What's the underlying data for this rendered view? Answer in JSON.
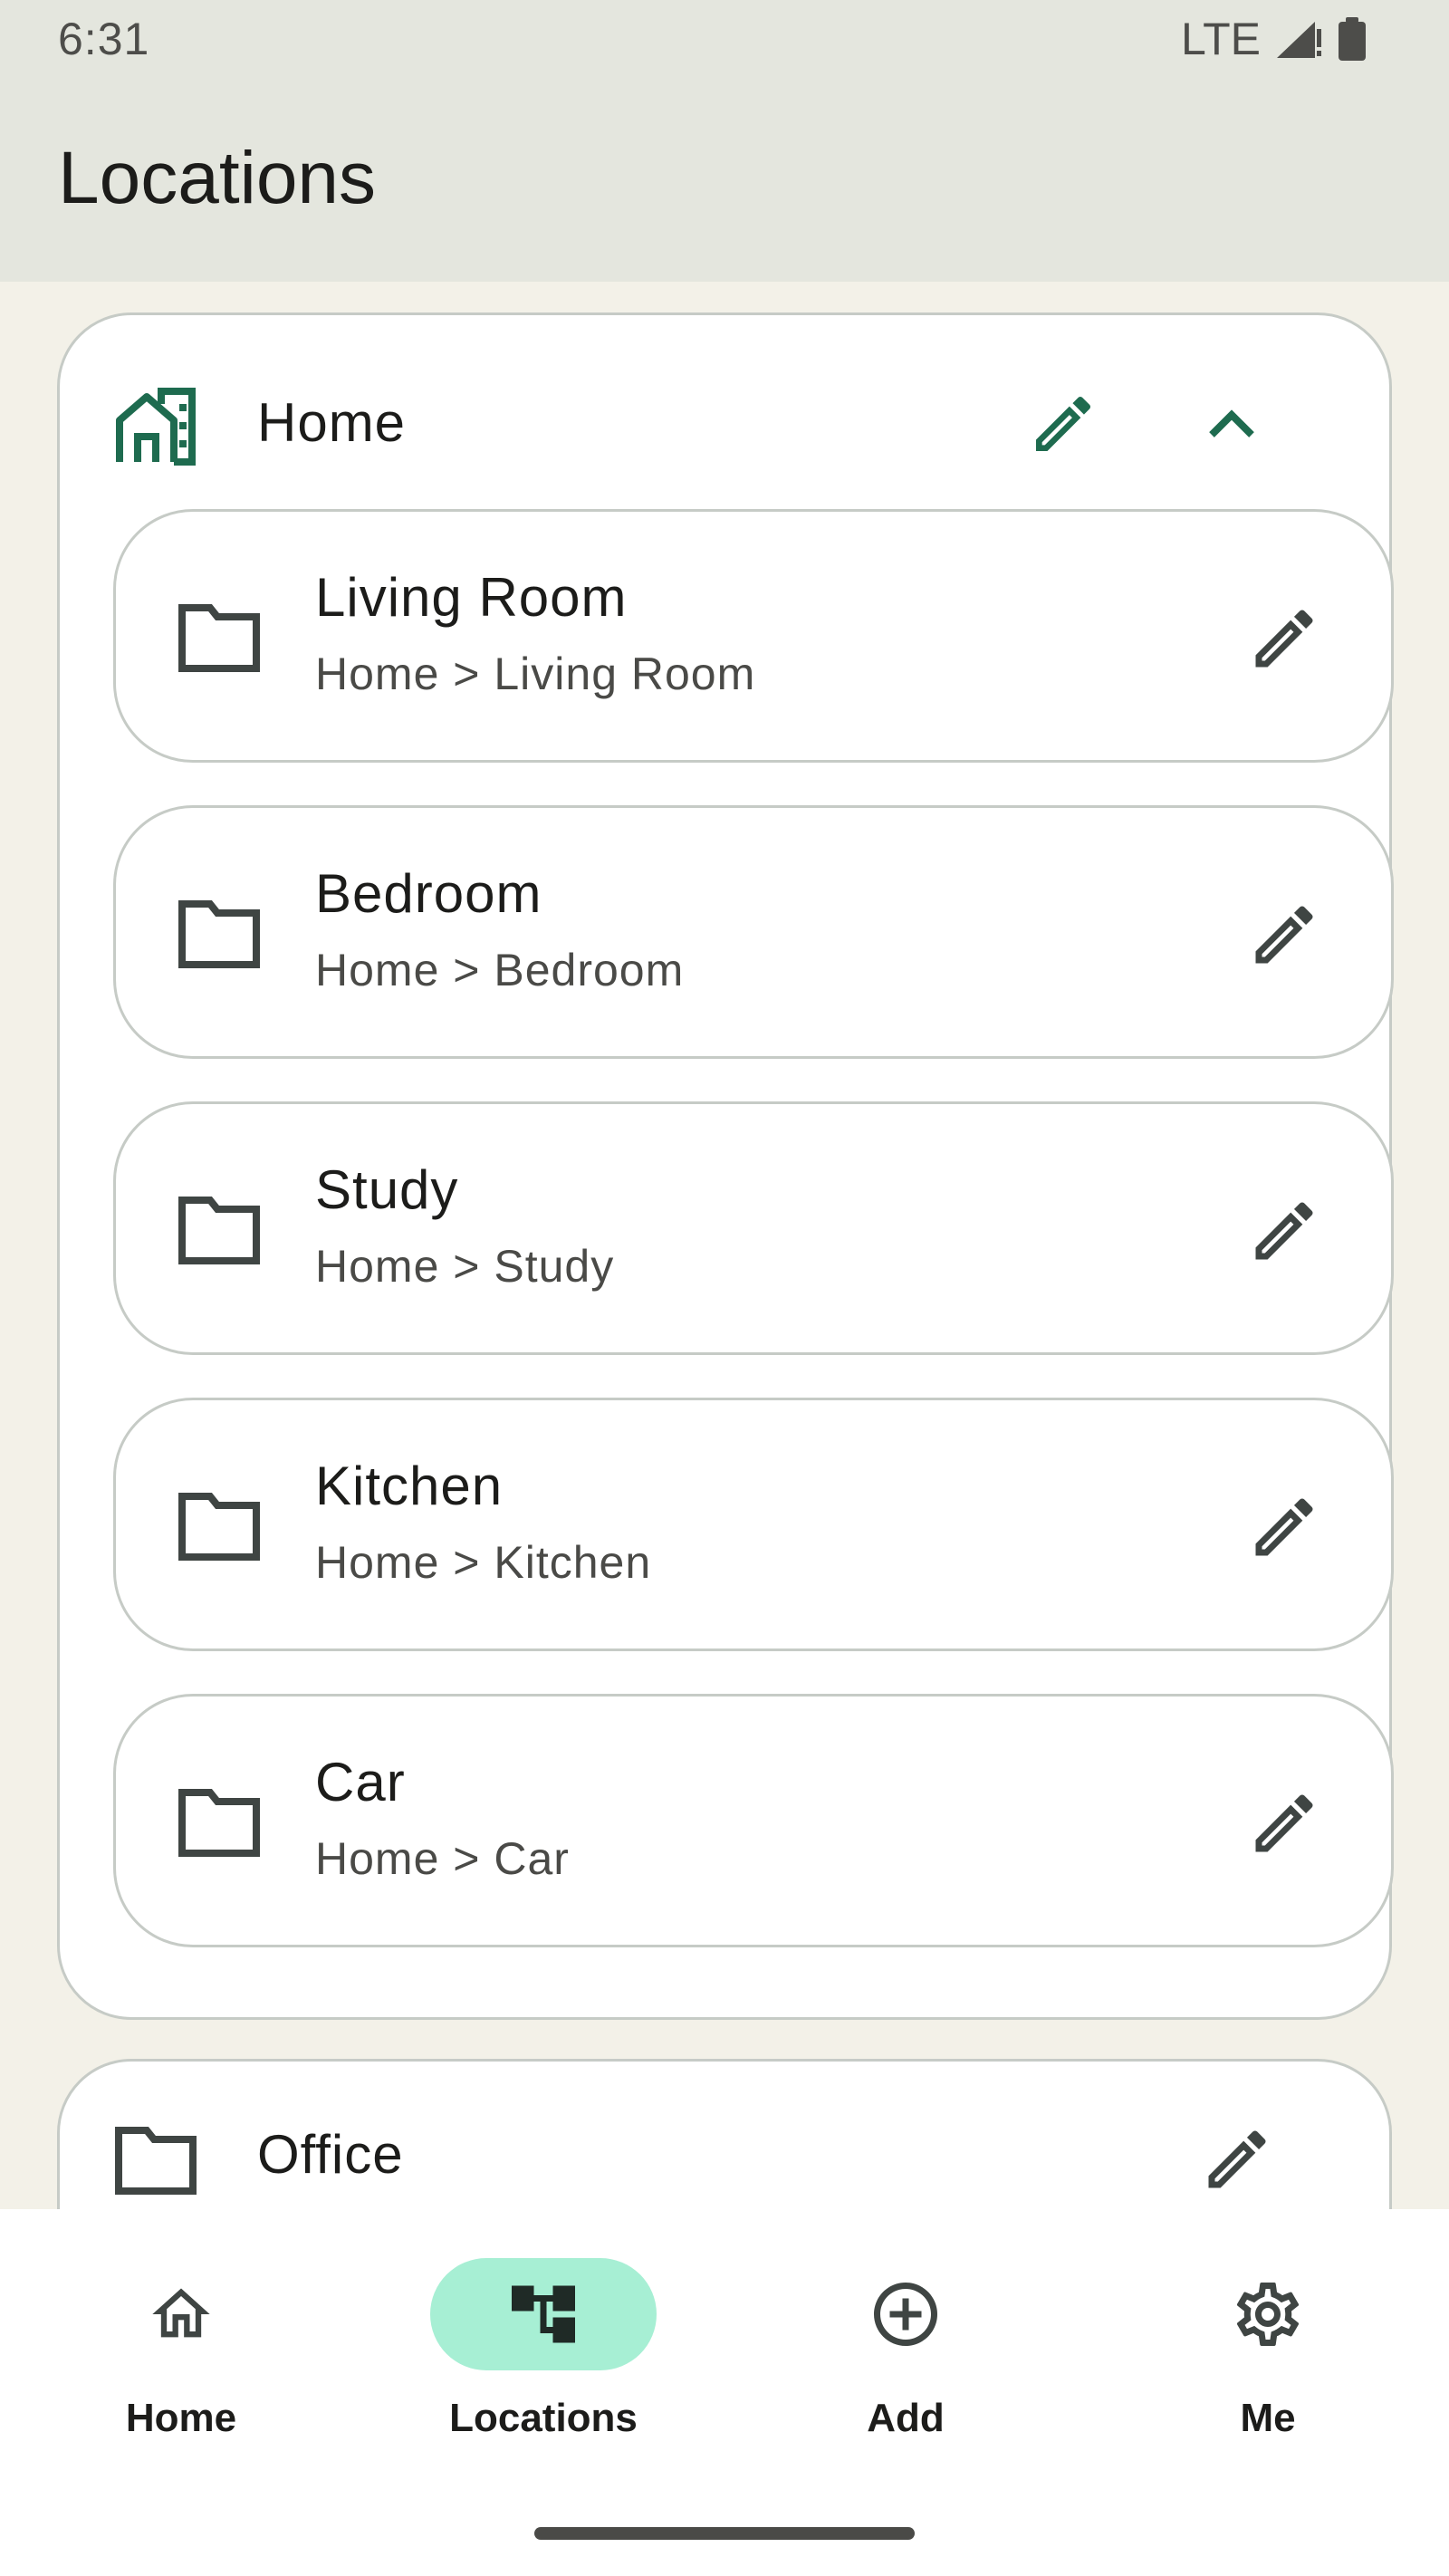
{
  "status_bar": {
    "time": "6:31",
    "network": "LTE",
    "icons": [
      "signal-icon",
      "battery-icon"
    ]
  },
  "header": {
    "title": "Locations"
  },
  "groups": [
    {
      "name": "Home",
      "icon": "home-building-icon",
      "expanded": true,
      "children": [
        {
          "title": "Living Room",
          "path": "Home > Living Room"
        },
        {
          "title": "Bedroom",
          "path": "Home > Bedroom"
        },
        {
          "title": "Study",
          "path": "Home > Study"
        },
        {
          "title": "Kitchen",
          "path": "Home > Kitchen"
        },
        {
          "title": "Car",
          "path": "Home > Car"
        }
      ]
    },
    {
      "name": "Office",
      "icon": "folder-icon",
      "expanded": false,
      "children": []
    }
  ],
  "bottom_nav": {
    "items": [
      {
        "label": "Home",
        "icon": "home-icon",
        "active": false
      },
      {
        "label": "Locations",
        "icon": "tree-icon",
        "active": true
      },
      {
        "label": "Add",
        "icon": "add-circle-icon",
        "active": false
      },
      {
        "label": "Me",
        "icon": "gear-icon",
        "active": false
      }
    ]
  },
  "colors": {
    "accent": "#1e6b4f",
    "active_pill": "#a7efd4",
    "background": "#f3f1e8",
    "app_bar": "#e4e6de"
  }
}
